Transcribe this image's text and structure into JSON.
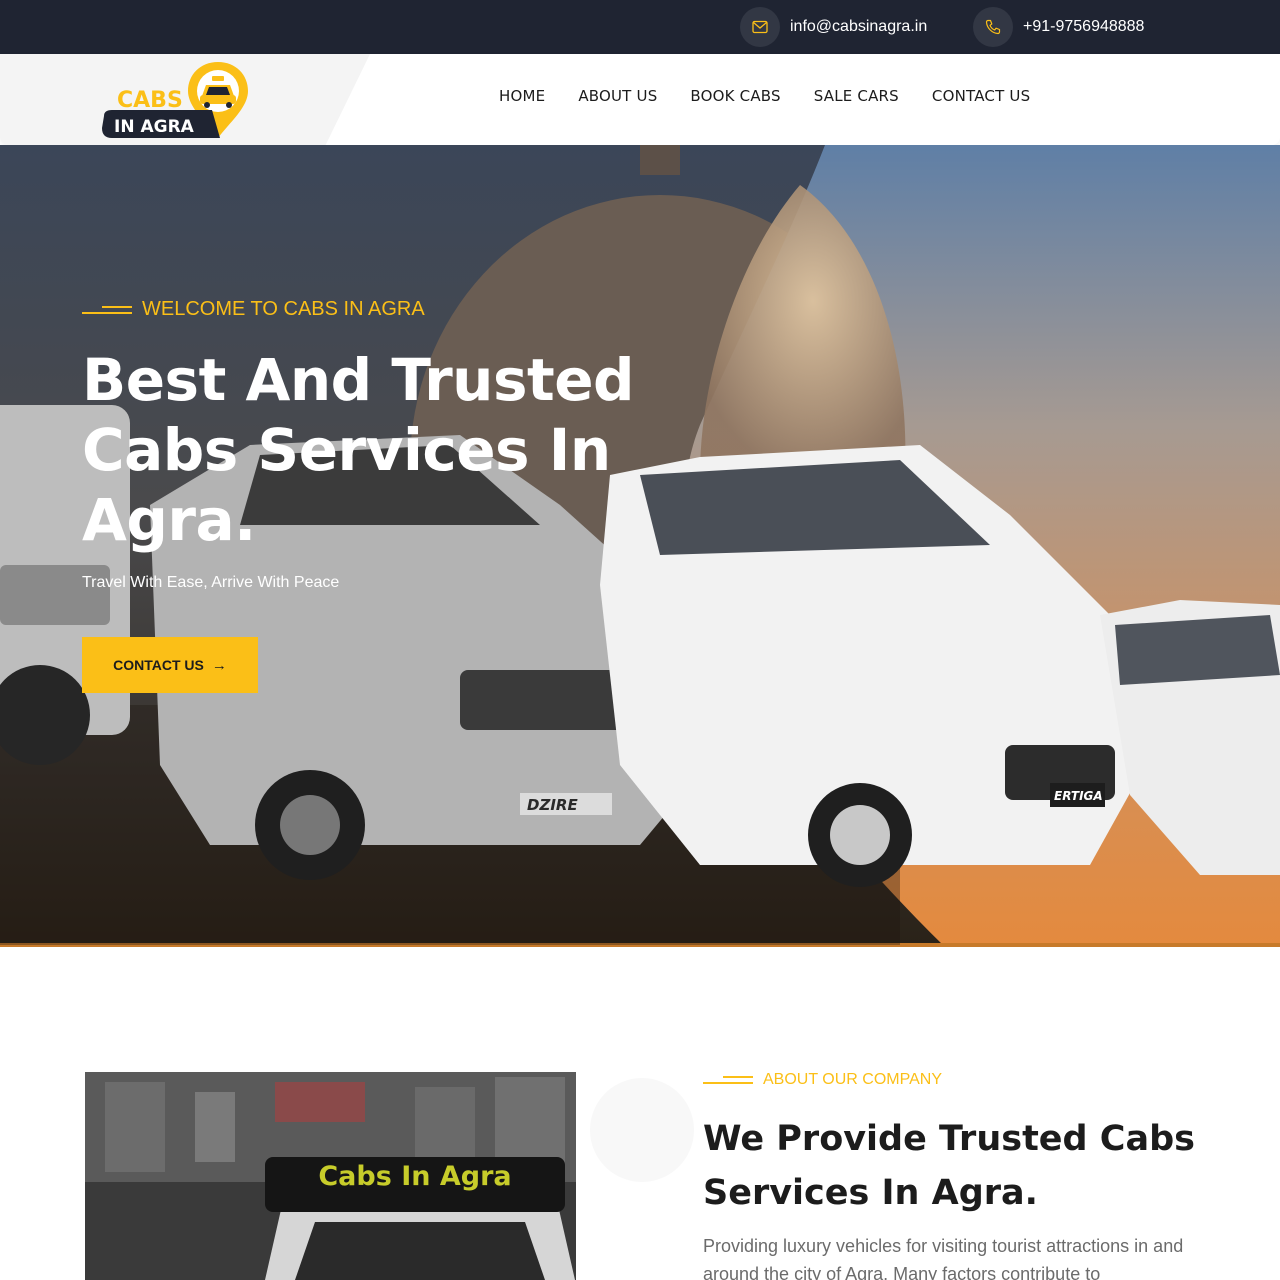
{
  "topbar": {
    "email": "info@cabsinagra.in",
    "phone": "+91-9756948888",
    "email_icon": "envelope-icon",
    "phone_icon": "phone-icon"
  },
  "header": {
    "logo_text_line1": "CABS",
    "logo_text_line2": "IN AGRA",
    "nav": [
      {
        "label": "HOME"
      },
      {
        "label": "ABOUT US"
      },
      {
        "label": "BOOK CABS"
      },
      {
        "label": "SALE CARS"
      },
      {
        "label": "CONTACT US"
      }
    ]
  },
  "hero": {
    "subtitle": "WELCOME TO CABS IN AGRA",
    "title": "Best And Trusted Cabs Services In Agra.",
    "tagline": "Travel With Ease, Arrive With Peace",
    "cta_label": "CONTACT US",
    "cta_icon": "arrow-right-icon",
    "car_plates": [
      "DZIRE",
      "ERTIGA"
    ]
  },
  "about": {
    "subtitle": "ABOUT OUR COMPANY",
    "title": "We Provide Trusted Cabs Services In Agra.",
    "text": "Providing luxury vehicles for visiting tourist attractions in and around the city of Agra. Many factors contribute to",
    "image_sign": "Cabs In Agra"
  },
  "colors": {
    "accent": "#fbbf17",
    "topbar_bg": "#1f2432",
    "dark_text": "#1c1c1c",
    "body_text": "#6b6b6b"
  }
}
